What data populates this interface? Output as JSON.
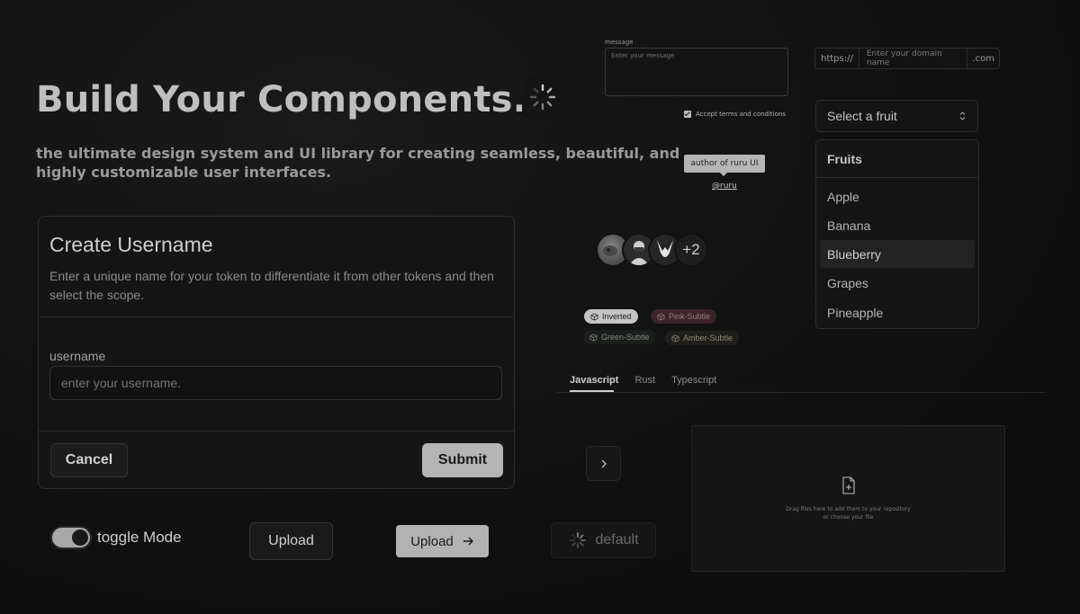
{
  "hero": {
    "title": "Build Your Components.",
    "subtitle": "the ultimate design system and UI library for creating seamless, beautiful, and highly customizable user interfaces."
  },
  "card": {
    "title": "Create Username",
    "description": "Enter a unique name for your token to differentiate it from other tokens and then select the scope.",
    "field_label": "username",
    "field_placeholder": "enter your username.",
    "cancel_label": "Cancel",
    "submit_label": "Submit"
  },
  "bottom_controls": {
    "toggle_label": "toggle Mode",
    "toggle_on": true,
    "upload_outline_label": "Upload",
    "upload_solid_label": "Upload",
    "default_label": "default"
  },
  "message": {
    "label": "message",
    "placeholder": "Enter your message",
    "terms_label": "Accept terms and conditions",
    "terms_checked": true
  },
  "tooltip": {
    "text": "author of ruru UI",
    "link": "@ruru"
  },
  "avatars": {
    "more_label": "+2"
  },
  "badges": {
    "inverted": "Inverted",
    "pink": "Pink-Subtle",
    "green": "Green-Subtle",
    "amber": "Amber-Subtle"
  },
  "tabs": [
    "Javascript",
    "Rust",
    "Typescript"
  ],
  "dropzone": {
    "line1": "Drag files here to add them to your repository",
    "line2": "or  choose your file"
  },
  "domain": {
    "prefix": "https://",
    "placeholder": "Enter your domain name",
    "suffix": ".com"
  },
  "select": {
    "placeholder": "Select a fruit",
    "group_label": "Fruits",
    "options": [
      "Apple",
      "Banana",
      "Blueberry",
      "Grapes",
      "Pineapple"
    ],
    "highlighted": "Blueberry"
  }
}
